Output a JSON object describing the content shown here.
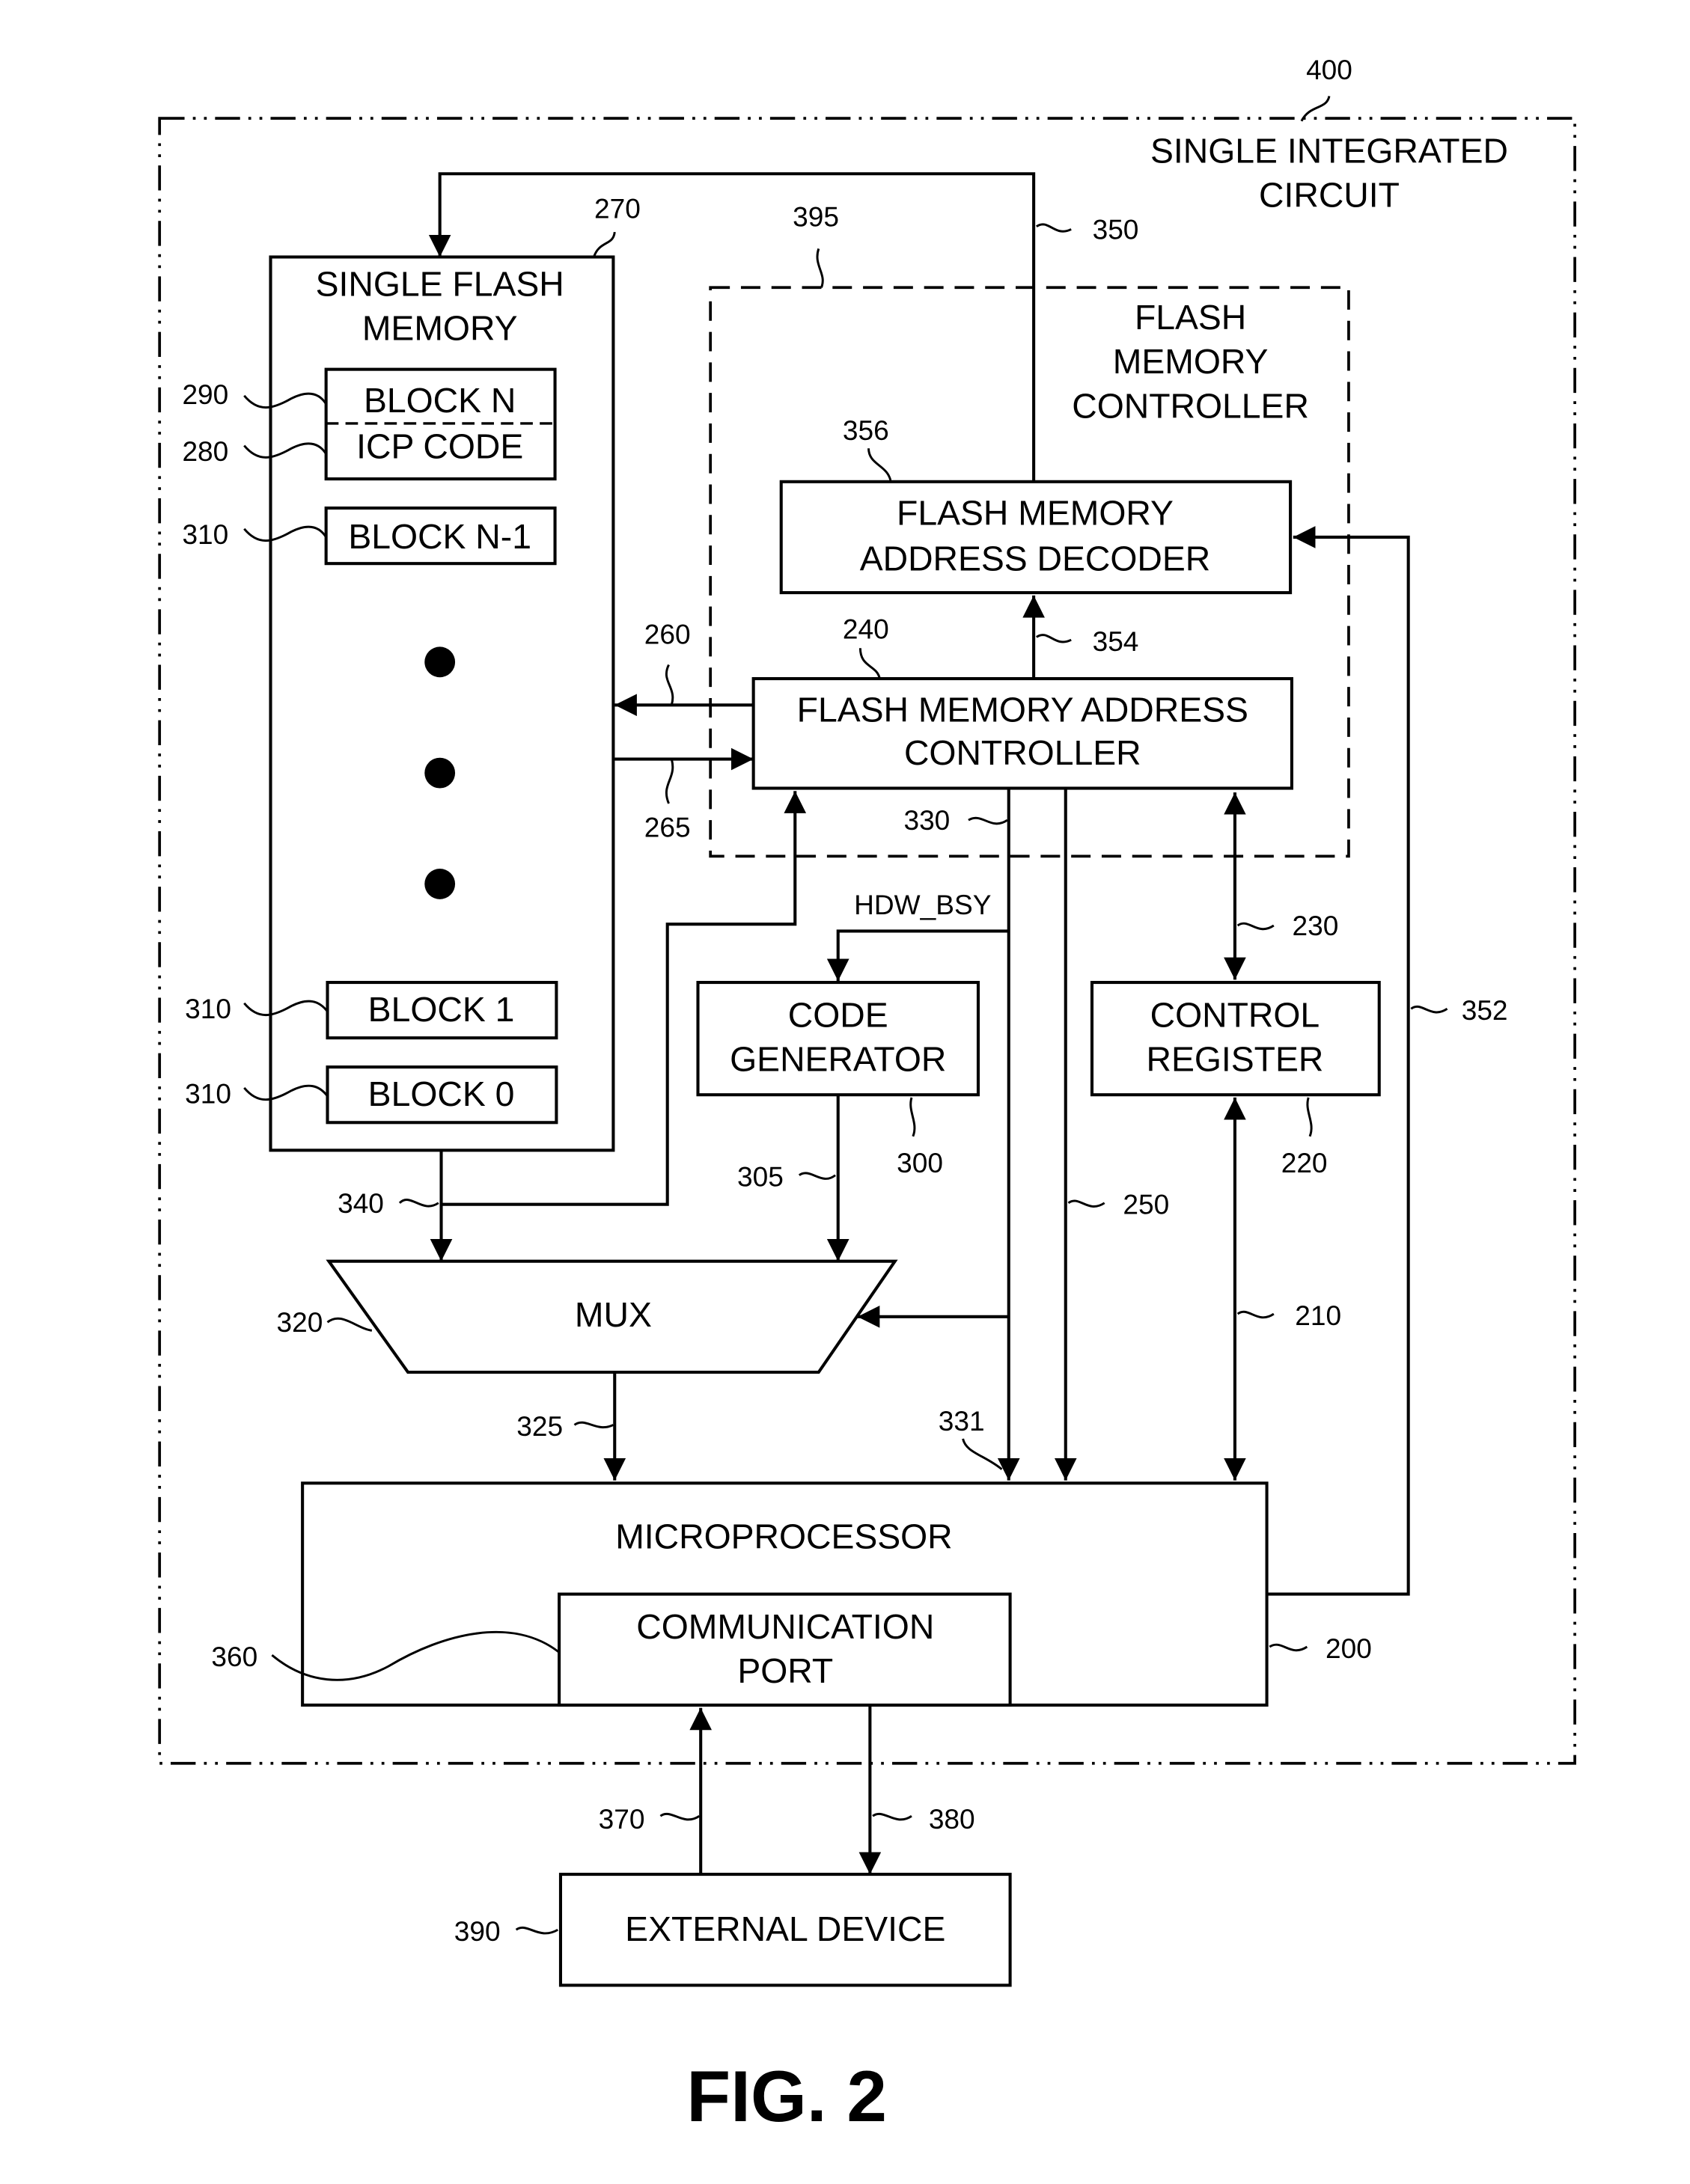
{
  "figure": {
    "caption": "FIG. 2",
    "container": {
      "ref": "400",
      "title_line1": "SINGLE INTEGRATED",
      "title_line2": "CIRCUIT"
    },
    "controller_group": {
      "ref": "395",
      "title_line1": "FLASH",
      "title_line2": "MEMORY",
      "title_line3": "CONTROLLER"
    },
    "flash_memory": {
      "ref": "270",
      "title_line1": "SINGLE FLASH",
      "title_line2": "MEMORY",
      "blocks": [
        {
          "label": "BLOCK N",
          "ref": "290"
        },
        {
          "label": "ICP CODE",
          "ref": "280"
        },
        {
          "label": "BLOCK N-1",
          "ref": "310"
        },
        {
          "label": "BLOCK 1",
          "ref": "310"
        },
        {
          "label": "BLOCK 0",
          "ref": "310"
        }
      ]
    },
    "decoder": {
      "ref": "356",
      "line1": "FLASH MEMORY",
      "line2": "ADDRESS DECODER"
    },
    "address_controller": {
      "ref": "240",
      "line1": "FLASH MEMORY ADDRESS",
      "line2": "CONTROLLER"
    },
    "code_generator": {
      "ref": "300",
      "line1": "CODE",
      "line2": "GENERATOR"
    },
    "control_register": {
      "ref": "220",
      "line1": "CONTROL",
      "line2": "REGISTER"
    },
    "mux": {
      "ref": "320",
      "label": "MUX"
    },
    "microprocessor": {
      "ref": "200",
      "label": "MICROPROCESSOR"
    },
    "comm_port": {
      "ref": "360",
      "line1": "COMMUNICATION",
      "line2": "PORT"
    },
    "external_device": {
      "ref": "390",
      "label": "EXTERNAL DEVICE"
    },
    "signals": {
      "s350": "350",
      "s354": "354",
      "s260": "260",
      "s265": "265",
      "s330": "330",
      "s331": "331",
      "s340": "340",
      "s305": "305",
      "s325": "325",
      "s250": "250",
      "s230": "230",
      "s210": "210",
      "s352": "352",
      "s370": "370",
      "s380": "380",
      "hdw_bsy": "HDW_BSY"
    }
  }
}
